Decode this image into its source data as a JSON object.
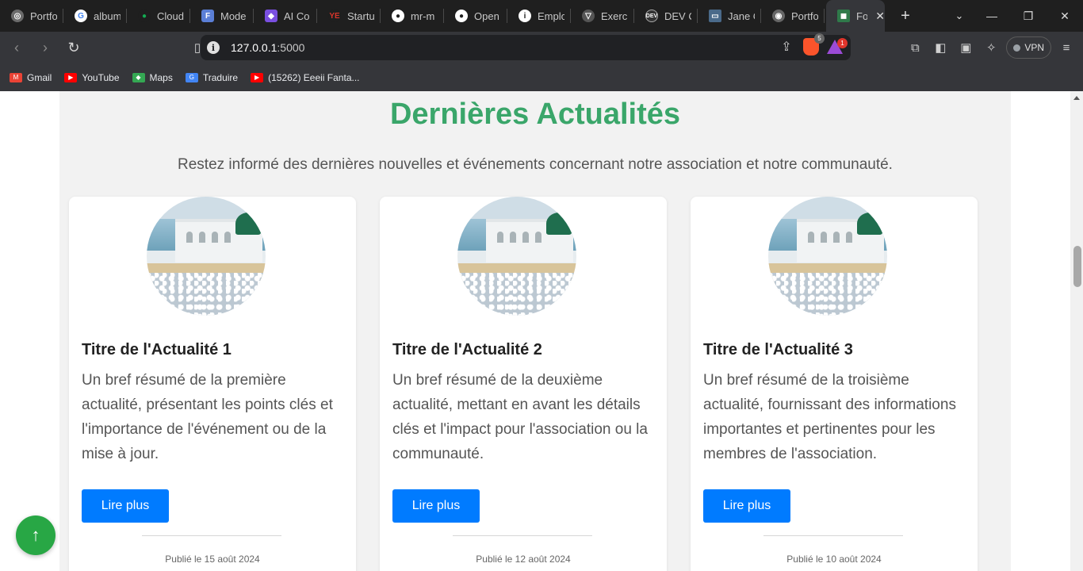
{
  "tabs": [
    {
      "label": "Portfo",
      "icon": "portfolio-icon",
      "color": "#6b6b6b"
    },
    {
      "label": "album",
      "icon": "google-icon",
      "color": "#4285f4"
    },
    {
      "label": "Cloud",
      "icon": "mongodb-icon",
      "color": "#13aa52"
    },
    {
      "label": "Mode",
      "icon": "app-icon",
      "color": "#5b7fd6"
    },
    {
      "label": "AI Co",
      "icon": "ai-icon",
      "color": "#7a4fe0"
    },
    {
      "label": "Startu",
      "icon": "startup-icon",
      "color": "#d8352b"
    },
    {
      "label": "mr-m",
      "icon": "github-icon",
      "color": "#444444"
    },
    {
      "label": "Open",
      "icon": "github-icon",
      "color": "#444444"
    },
    {
      "label": "Emplo",
      "icon": "info-icon",
      "color": "#555555"
    },
    {
      "label": "Exerci",
      "icon": "exercise-icon",
      "color": "#555555"
    },
    {
      "label": "DEV C",
      "icon": "dev-icon",
      "color": "#333333"
    },
    {
      "label": "Jane C",
      "icon": "laptop-icon",
      "color": "#4a6a8a"
    },
    {
      "label": "Portfo",
      "icon": "globe-icon",
      "color": "#666666"
    }
  ],
  "active_tab": {
    "label": "Fo",
    "icon": "site-icon",
    "color": "#2f7a4a"
  },
  "omnibox": {
    "url_host": "127.0.0.1",
    "url_port": ":5000",
    "brave_badge": "5",
    "rewards_badge": "1"
  },
  "vpn_label": "VPN",
  "bookmarks": [
    {
      "label": "Gmail",
      "icon": "gmail-icon",
      "color": "#ea4335"
    },
    {
      "label": "YouTube",
      "icon": "youtube-icon",
      "color": "#ff0000"
    },
    {
      "label": "Maps",
      "icon": "maps-icon",
      "color": "#34a853"
    },
    {
      "label": "Traduire",
      "icon": "translate-icon",
      "color": "#4285f4"
    },
    {
      "label": "(15262) Eeeii Fanta...",
      "icon": "youtube-icon",
      "color": "#ff0000"
    }
  ],
  "page": {
    "title": "Dernières Actualités",
    "lead": "Restez informé des dernières nouvelles et événements concernant notre association et notre communauté.",
    "accent_color": "#3aa66a",
    "button_color": "#007bff",
    "cards": [
      {
        "title": "Titre de l'Actualité 1",
        "summary": "Un bref résumé de la première actualité, présentant les points clés et l'importance de l'événement ou de la mise à jour.",
        "button": "Lire plus",
        "date": "Publié le 15 août 2024"
      },
      {
        "title": "Titre de l'Actualité 2",
        "summary": "Un bref résumé de la deuxième actualité, mettant en avant les détails clés et l'impact pour l'association ou la communauté.",
        "button": "Lire plus",
        "date": "Publié le 12 août 2024"
      },
      {
        "title": "Titre de l'Actualité 3",
        "summary": "Un bref résumé de la troisième actualité, fournissant des informations importantes et pertinentes pour les membres de l'association.",
        "button": "Lire plus",
        "date": "Publié le 10 août 2024"
      }
    ]
  },
  "scroll_to_top_icon": "arrow-up-icon"
}
